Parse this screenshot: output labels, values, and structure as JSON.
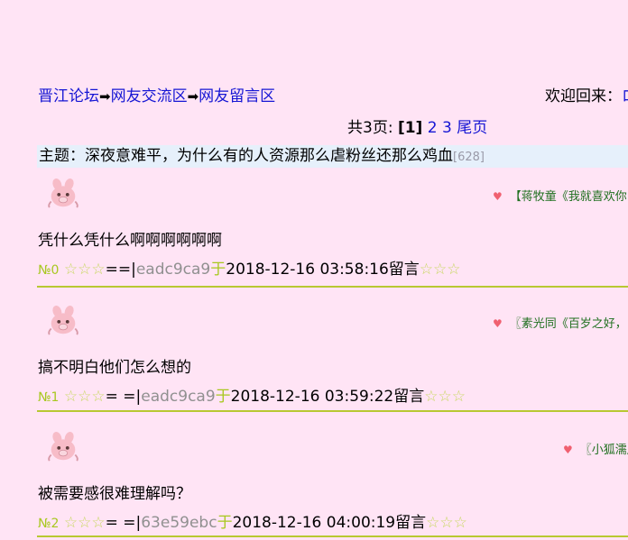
{
  "breadcrumb": {
    "forum": "晋江论坛",
    "board": "网友交流区",
    "section": "网友留言区",
    "arrow": "➡"
  },
  "welcome": {
    "text": "欢迎回来：",
    "user": "ロ"
  },
  "pager": {
    "prefix": "共3页:",
    "current": "[1]",
    "pages": [
      "2",
      "3"
    ],
    "last": "尾页"
  },
  "topic": {
    "label": "主题：深夜意难平，为什么有的人资源那么虐粉丝还那么鸡血",
    "count": "[628]"
  },
  "posts": [
    {
      "signature": "【蒋牧童《我就喜欢你",
      "content": "凭什么凭什么啊啊啊啊啊啊",
      "floor": "№0",
      "stars": "☆☆☆",
      "sep": "==|",
      "author": "eadc9ca9",
      "yu": "于",
      "time": "2018-12-16 03:58:16留言",
      "stars2": "☆☆☆"
    },
    {
      "signature": "〖素光同《百岁之好，",
      "content": "搞不明白他们怎么想的",
      "floor": "№1",
      "stars": "☆☆☆",
      "sep": "= =|",
      "author": "eadc9ca9",
      "yu": "于",
      "time": "2018-12-16 03:59:22留言",
      "stars2": "☆☆☆"
    },
    {
      "signature": "〖小狐濡尾",
      "content": "被需要感很难理解吗？",
      "floor": "№2",
      "stars": "☆☆☆",
      "sep": "= =|",
      "author": "63e59ebc",
      "yu": "于",
      "time": "2018-12-16 04:00:19留言",
      "stars2": "☆☆☆"
    }
  ],
  "colors": {
    "background": "#FFE4F5",
    "link": "#1515d4",
    "divider": "#b8c832",
    "floor": "#a8c820",
    "heart": "#f06070"
  }
}
